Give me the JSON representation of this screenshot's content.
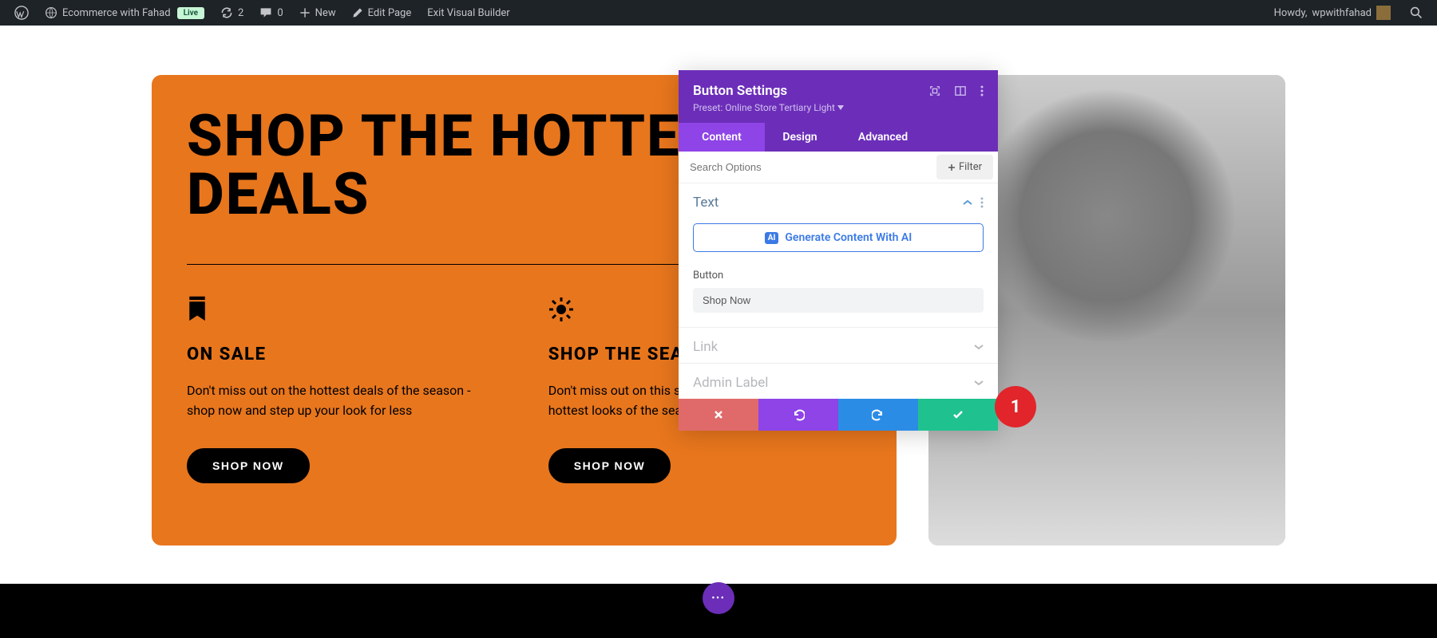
{
  "adminbar": {
    "site_name": "Ecommerce with Fahad",
    "live_badge": "Live",
    "updates_count": "2",
    "comments_count": "0",
    "new_label": "New",
    "edit_page": "Edit Page",
    "exit_vb": "Exit Visual Builder",
    "howdy_prefix": "Howdy, ",
    "username": "wpwithfahad"
  },
  "hero": {
    "title": "SHOP THE HOTTEST DEALS",
    "col1": {
      "icon": "bookmark-icon",
      "title": "ON SALE",
      "text": "Don't miss out on the hottest deals of the season - shop now and step up your look for less",
      "button": "SHOP NOW"
    },
    "col2": {
      "icon": "sun-icon",
      "title": "SHOP THE SEASON",
      "text": "Don't miss out on this season's must-haves - the hottest looks of the season",
      "button": "SHOP NOW"
    }
  },
  "modal": {
    "title": "Button Settings",
    "preset_label": "Preset: Online Store Tertiary Light",
    "tabs": {
      "content": "Content",
      "design": "Design",
      "advanced": "Advanced"
    },
    "search_placeholder": "Search Options",
    "filter_label": "Filter",
    "sections": {
      "text": "Text",
      "ai_button": "Generate Content With AI",
      "ai_badge": "AI",
      "button_field_label": "Button",
      "button_field_value": "Shop Now",
      "link": "Link",
      "admin_label": "Admin Label"
    },
    "notification_count": "1"
  },
  "colors": {
    "accent_purple": "#6c2eb9",
    "accent_purple_light": "#8e44e6",
    "orange": "#e8761d",
    "ok_green": "#1fc28f",
    "redo_blue": "#2b8ce6",
    "cancel_red": "#e06a6a",
    "notif_red": "#e1252a"
  }
}
